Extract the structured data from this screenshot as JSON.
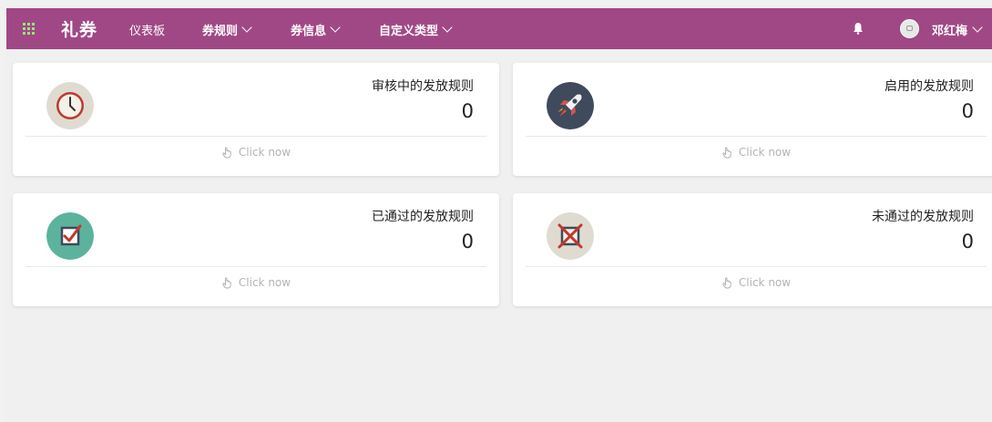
{
  "app": {
    "brand": "礼券"
  },
  "nav": {
    "dashboard": "仪表板",
    "coupon_rules": "券规则",
    "coupon_info": "券信息",
    "custom_types": "自定义类型"
  },
  "user": {
    "name": "邓红梅"
  },
  "cards": [
    {
      "title": "审核中的发放规则",
      "count": "0",
      "cta": "Click now",
      "icon": "clock-icon"
    },
    {
      "title": "启用的发放规则",
      "count": "0",
      "cta": "Click now",
      "icon": "rocket-icon"
    },
    {
      "title": "已通过的发放规则",
      "count": "0",
      "cta": "Click now",
      "icon": "checkbox-icon"
    },
    {
      "title": "未通过的发放规则",
      "count": "0",
      "cta": "Click now",
      "icon": "rejected-box-icon"
    }
  ],
  "colors": {
    "topbar": "#a04886",
    "apps_icon": "#9be37a",
    "page_bg": "#f0f0f0"
  }
}
